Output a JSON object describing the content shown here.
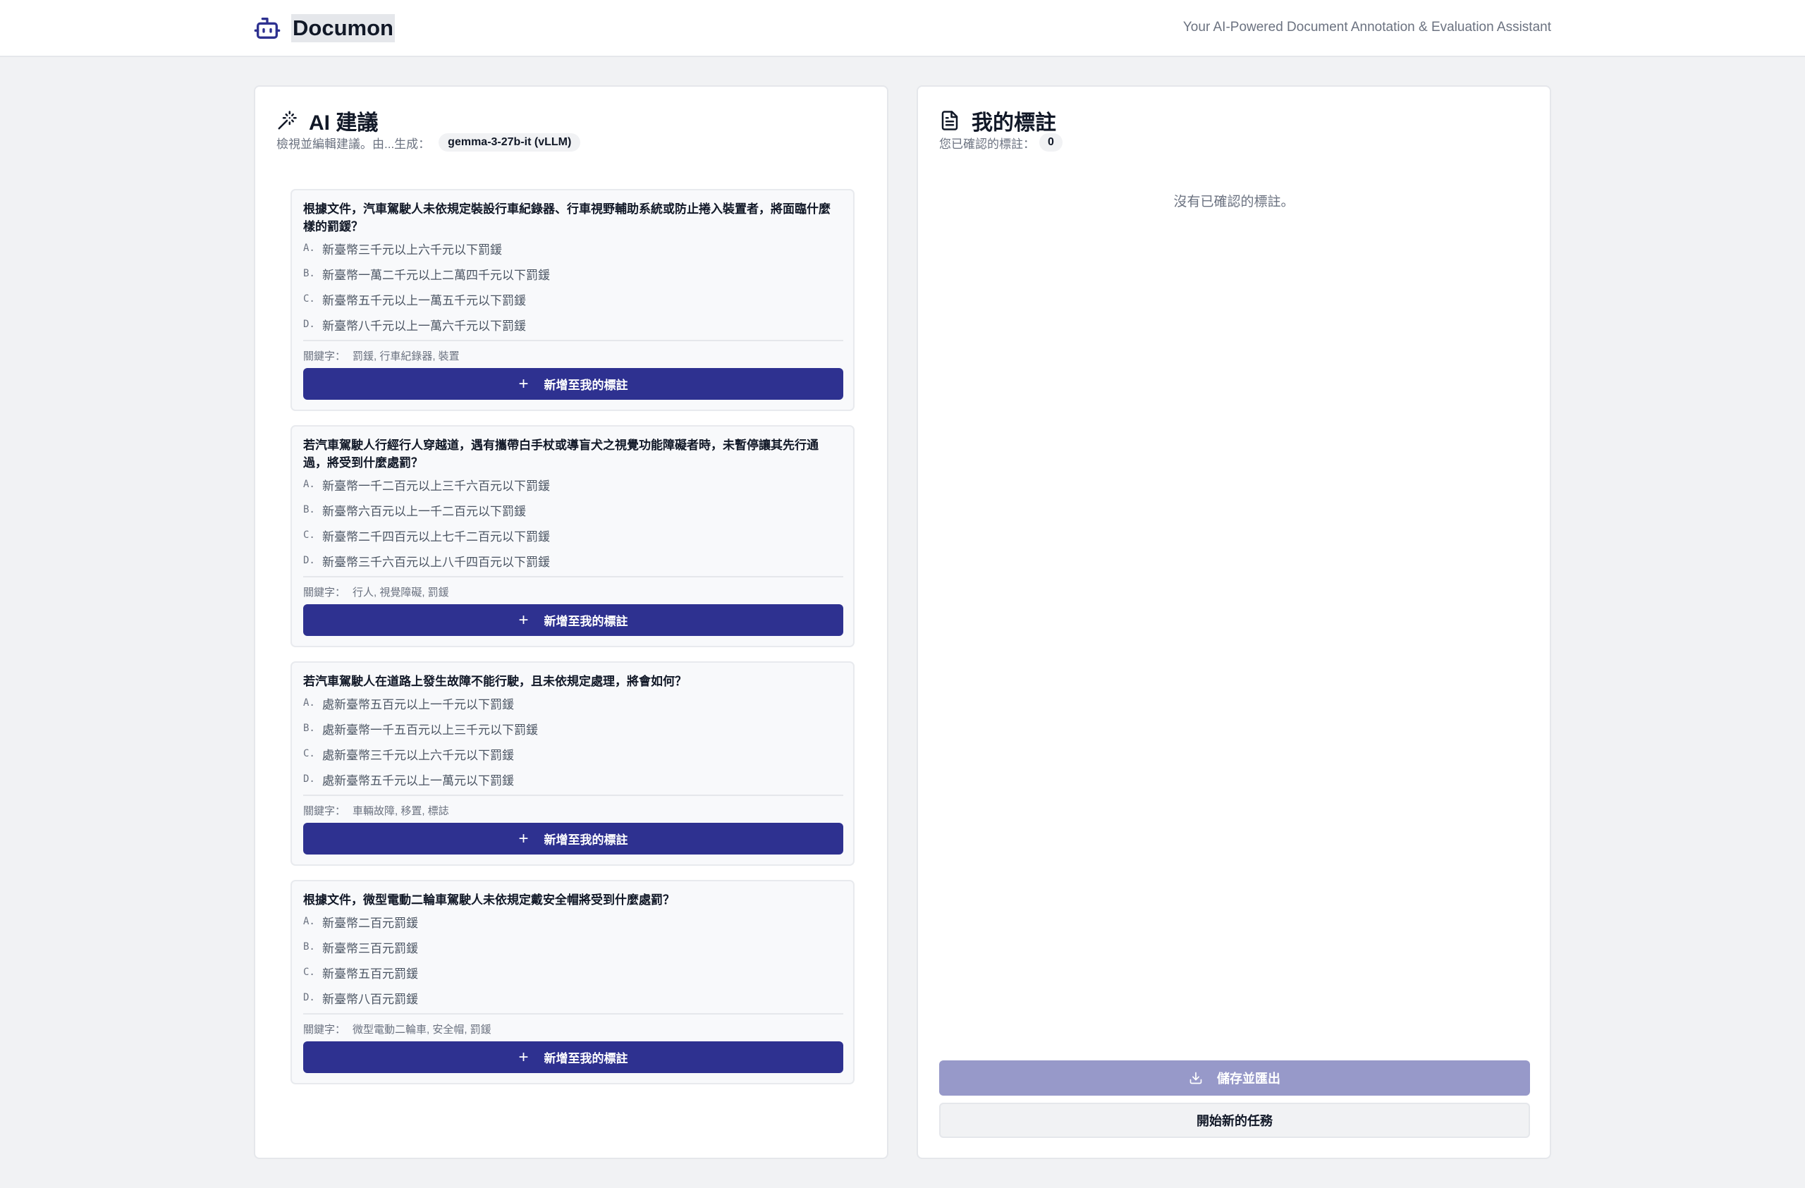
{
  "header": {
    "app_name": "Documon",
    "tagline": "Your AI-Powered Document Annotation & Evaluation Assistant",
    "logo_icon": "robot-icon"
  },
  "suggestions_panel": {
    "title": "AI 建議",
    "title_icon": "magic-wand-icon",
    "subtitle": "檢視並編輯建議。由...生成：",
    "model": "gemma-3-27b-it (vLLM)",
    "keywords_label": "關鍵字：",
    "add_button_label": "新增至我的標註",
    "cards": [
      {
        "question": "根據文件，汽車駕駛人未依規定裝設行車紀錄器、行車視野輔助系統或防止捲入裝置者，將面臨什麼樣的罰鍰？",
        "options": [
          {
            "letter": "A.",
            "text": "新臺幣三千元以上六千元以下罰鍰"
          },
          {
            "letter": "B.",
            "text": "新臺幣一萬二千元以上二萬四千元以下罰鍰"
          },
          {
            "letter": "C.",
            "text": "新臺幣五千元以上一萬五千元以下罰鍰"
          },
          {
            "letter": "D.",
            "text": "新臺幣八千元以上一萬六千元以下罰鍰"
          }
        ],
        "keywords": "罰鍰, 行車紀錄器, 裝置"
      },
      {
        "question": "若汽車駕駛人行經行人穿越道，遇有攜帶白手杖或導盲犬之視覺功能障礙者時，未暫停讓其先行通過，將受到什麼處罰？",
        "options": [
          {
            "letter": "A.",
            "text": "新臺幣一千二百元以上三千六百元以下罰鍰"
          },
          {
            "letter": "B.",
            "text": "新臺幣六百元以上一千二百元以下罰鍰"
          },
          {
            "letter": "C.",
            "text": "新臺幣二千四百元以上七千二百元以下罰鍰"
          },
          {
            "letter": "D.",
            "text": "新臺幣三千六百元以上八千四百元以下罰鍰"
          }
        ],
        "keywords": "行人, 視覺障礙, 罰鍰"
      },
      {
        "question": "若汽車駕駛人在道路上發生故障不能行駛，且未依規定處理，將會如何？",
        "options": [
          {
            "letter": "A.",
            "text": "處新臺幣五百元以上一千元以下罰鍰"
          },
          {
            "letter": "B.",
            "text": "處新臺幣一千五百元以上三千元以下罰鍰"
          },
          {
            "letter": "C.",
            "text": "處新臺幣三千元以上六千元以下罰鍰"
          },
          {
            "letter": "D.",
            "text": "處新臺幣五千元以上一萬元以下罰鍰"
          }
        ],
        "keywords": "車輛故障, 移置, 標誌"
      },
      {
        "question": "根據文件，微型電動二輪車駕駛人未依規定戴安全帽將受到什麼處罰？",
        "options": [
          {
            "letter": "A.",
            "text": "新臺幣二百元罰鍰"
          },
          {
            "letter": "B.",
            "text": "新臺幣三百元罰鍰"
          },
          {
            "letter": "C.",
            "text": "新臺幣五百元罰鍰"
          },
          {
            "letter": "D.",
            "text": "新臺幣八百元罰鍰"
          }
        ],
        "keywords": "微型電動二輪車, 安全帽, 罰鍰"
      }
    ]
  },
  "annotations_panel": {
    "title": "我的標註",
    "title_icon": "document-icon",
    "confirmed_label": "您已確認的標註：",
    "confirmed_count": "0",
    "empty_message": "沒有已確認的標註。",
    "export_button": "儲存並匯出",
    "export_icon": "download-icon",
    "new_task_button": "開始新的任務"
  },
  "colors": {
    "primary": "#2e3190",
    "primary_disabled": "#9799c9",
    "page_background": "#f1f2f4"
  }
}
